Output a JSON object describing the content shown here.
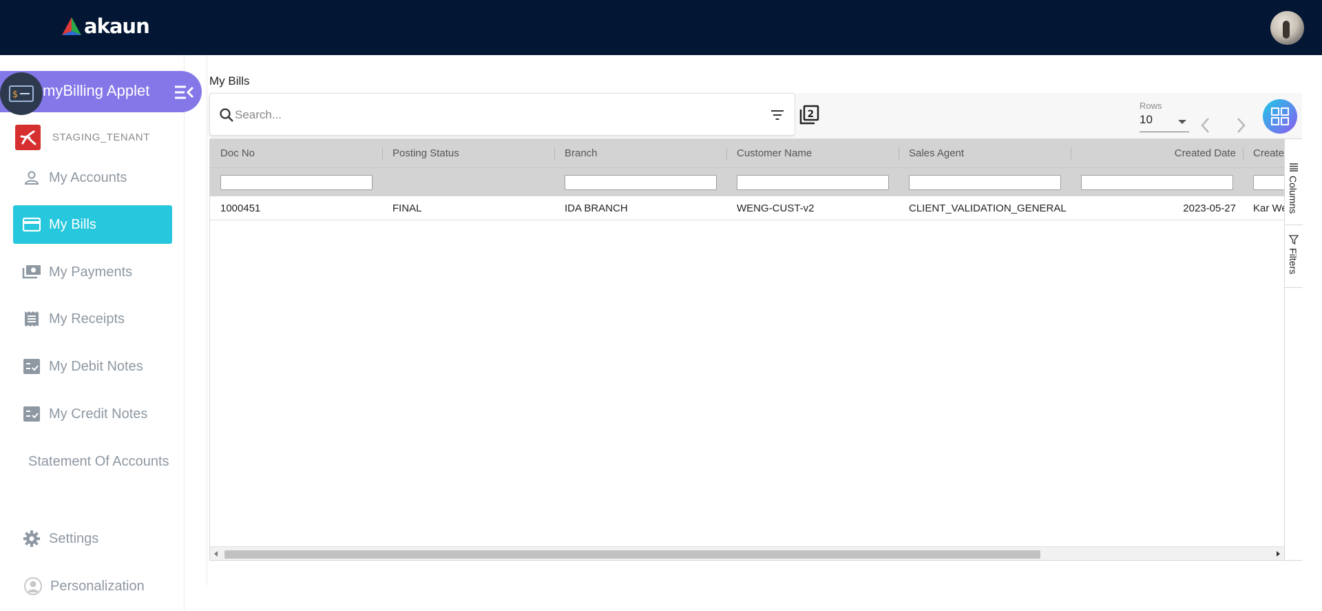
{
  "header": {
    "logo_text": "akaun",
    "avatar_alt": "user-avatar"
  },
  "sidebar": {
    "applet_title": "myBilling Applet",
    "tenant": "STAGING_TENANT",
    "items": [
      {
        "label": "My Accounts",
        "icon": "person-icon",
        "active": false
      },
      {
        "label": "My Bills",
        "icon": "credit-card-icon",
        "active": true
      },
      {
        "label": "My Payments",
        "icon": "payments-icon",
        "active": false
      },
      {
        "label": "My Receipts",
        "icon": "receipt-icon",
        "active": false
      },
      {
        "label": "My Debit Notes",
        "icon": "checklist-icon",
        "active": false
      },
      {
        "label": "My Credit Notes",
        "icon": "checklist-icon",
        "active": false
      },
      {
        "label": "Statement Of Accounts",
        "icon": "",
        "active": false
      },
      {
        "label": "Settings",
        "icon": "gear-icon",
        "active": false
      },
      {
        "label": "Personalization",
        "icon": "account-circle-icon",
        "active": false
      }
    ]
  },
  "main": {
    "title": "My Bills",
    "search_placeholder": "Search...",
    "rows_label": "Rows",
    "rows_value": "10",
    "columns": [
      "Doc No",
      "Posting Status",
      "Branch",
      "Customer Name",
      "Sales Agent",
      "Created Date",
      "Create"
    ],
    "rows": [
      [
        "1000451",
        "FINAL",
        "IDA BRANCH",
        "WENG-CUST-v2",
        "CLIENT_VALIDATION_GENERAL",
        "2023-05-27",
        "Kar We"
      ]
    ],
    "side_tabs": {
      "columns": "Columns",
      "filters": "Filters"
    }
  },
  "colors": {
    "topbar": "#031633",
    "applet_accent": "#8477e8",
    "active_nav": "#27c7dd",
    "grid_header": "#d3d3d3"
  }
}
